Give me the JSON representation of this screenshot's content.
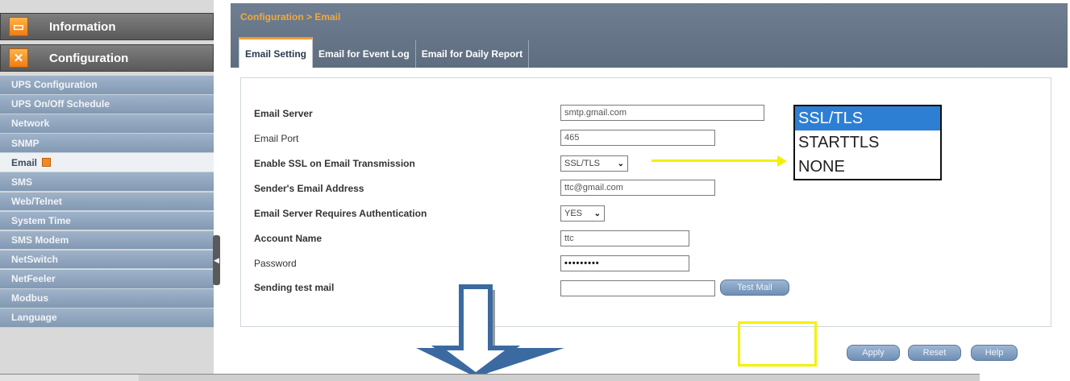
{
  "sidebar": {
    "sections": [
      {
        "label": "Information",
        "icon": "info-panel-icon"
      },
      {
        "label": "Configuration",
        "icon": "tools-icon"
      }
    ],
    "items": [
      {
        "label": "UPS Configuration"
      },
      {
        "label": "UPS On/Off Schedule"
      },
      {
        "label": "Network"
      },
      {
        "label": "SNMP"
      },
      {
        "label": "Email",
        "active": true
      },
      {
        "label": "SMS"
      },
      {
        "label": "Web/Telnet"
      },
      {
        "label": "System Time"
      },
      {
        "label": "SMS Modem"
      },
      {
        "label": "NetSwitch"
      },
      {
        "label": "NetFeeler"
      },
      {
        "label": "Modbus"
      },
      {
        "label": "Language"
      }
    ]
  },
  "header": {
    "breadcrumb": "Configuration > Email",
    "tabs": [
      {
        "label": "Email Setting",
        "active": true
      },
      {
        "label": "Email for Event Log"
      },
      {
        "label": "Email for Daily Report"
      }
    ]
  },
  "form": {
    "email_server": {
      "label": "Email Server",
      "value": "smtp.gmail.com"
    },
    "email_port": {
      "label": "Email Port",
      "value": "465"
    },
    "enable_ssl": {
      "label": "Enable SSL on Email Transmission",
      "value": "SSL/TLS"
    },
    "sender_address": {
      "label": "Sender's Email Address",
      "value": "ttc@gmail.com"
    },
    "requires_auth": {
      "label": "Email Server Requires Authentication",
      "value": "YES"
    },
    "account_name": {
      "label": "Account Name",
      "value": "ttc"
    },
    "password": {
      "label": "Password",
      "value": "•••••••••"
    },
    "test_mail": {
      "label": "Sending test mail",
      "value": "",
      "button": "Test Mail"
    }
  },
  "ssl_dropdown": {
    "options": [
      "SSL/TLS",
      "STARTTLS",
      "NONE"
    ],
    "selected": "SSL/TLS"
  },
  "actions": {
    "apply": "Apply",
    "reset": "Reset",
    "help": "Help"
  },
  "colors": {
    "accent": "#f39c2a",
    "highlight": "#f5f000",
    "down_arrow": "#3b6aa0"
  }
}
